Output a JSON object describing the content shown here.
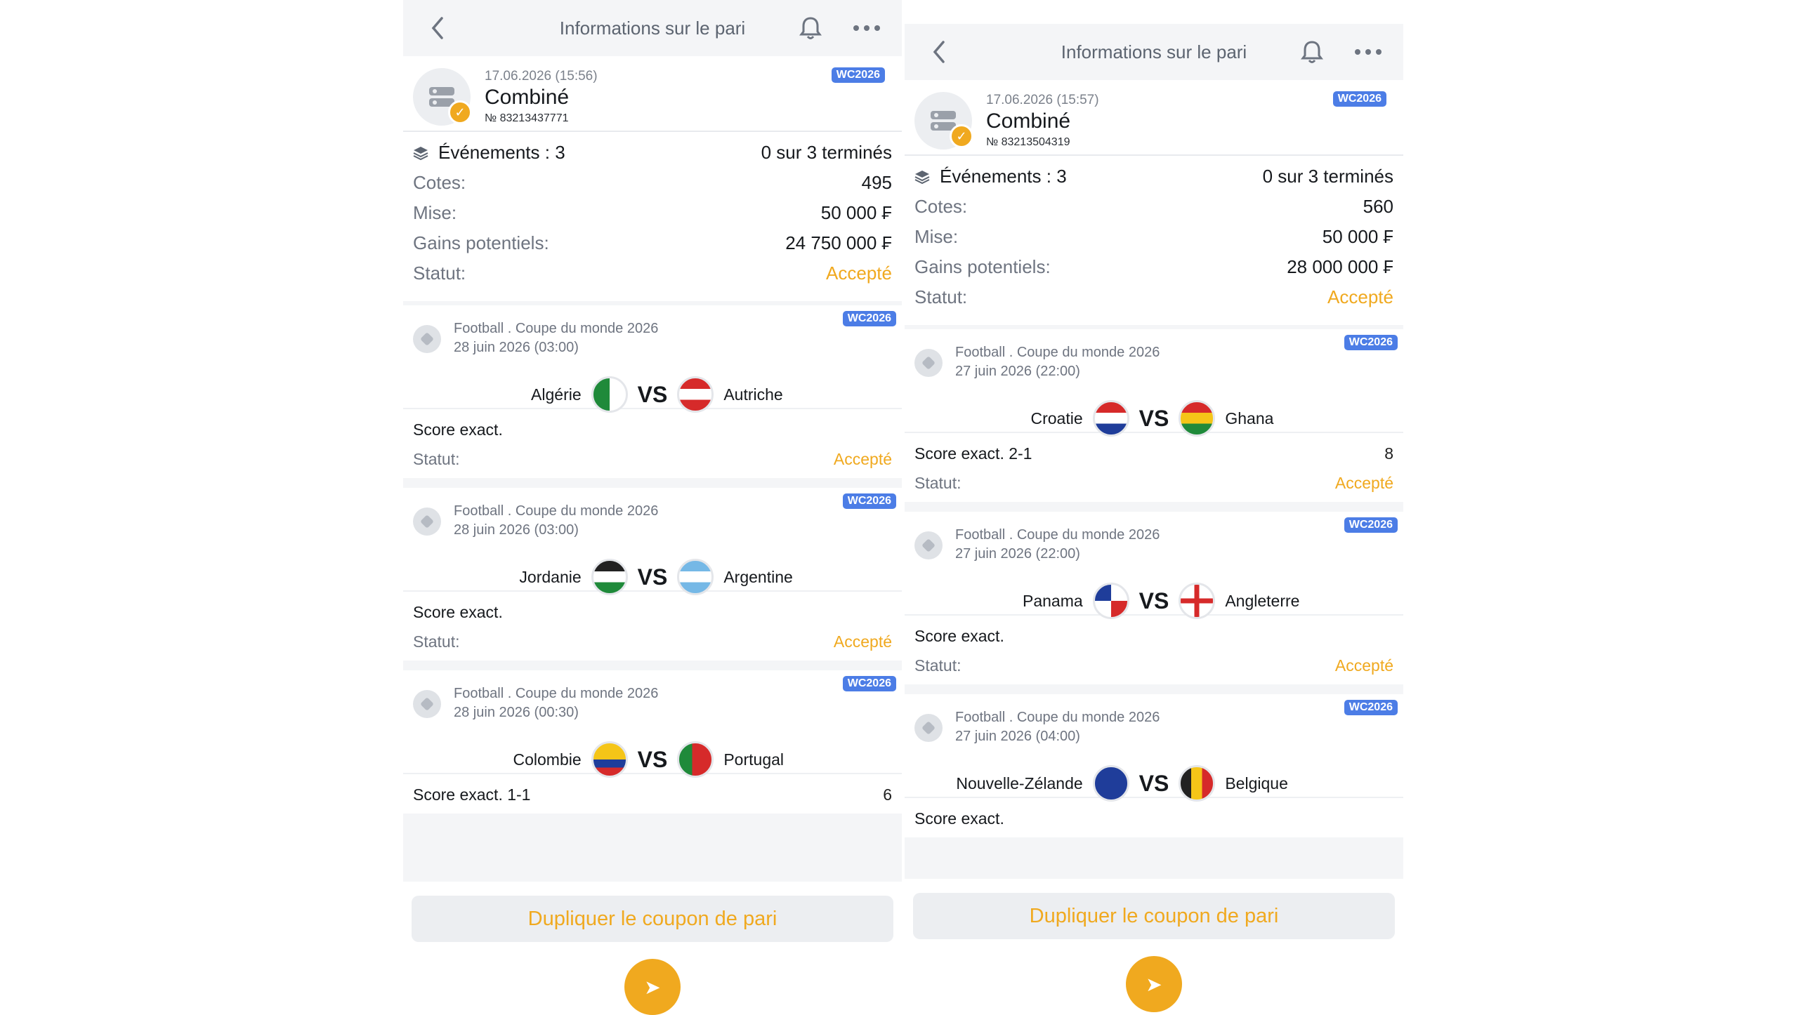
{
  "panels": [
    {
      "header_title": "Informations sur le pari",
      "bet": {
        "date": "17.06.2026 (15:56)",
        "type": "Combiné",
        "number": "№ 83213437771",
        "badge": "WC2026"
      },
      "summary": {
        "events_label": "Événements : 3",
        "events_value": "0 sur 3 terminés",
        "odds_label": "Cotes:",
        "odds_value": "495",
        "stake_label": "Mise:",
        "stake_value": "50 000 ₣",
        "potential_label": "Gains potentiels:",
        "potential_value": "24 750 000 ₣",
        "status_label": "Statut:",
        "status_value": "Accepté"
      },
      "events": [
        {
          "badge": "WC2026",
          "league": "Football . Coupe du monde 2026",
          "date": "28 juin 2026 (03:00)",
          "home": "Algérie",
          "away": "Autriche",
          "vs": "VS",
          "pick": "Score exact.",
          "pick_value": "",
          "status_label": "Statut:",
          "status_value": "Accepté"
        },
        {
          "badge": "WC2026",
          "league": "Football . Coupe du monde 2026",
          "date": "28 juin 2026 (03:00)",
          "home": "Jordanie",
          "away": "Argentine",
          "vs": "VS",
          "pick": "Score exact.",
          "pick_value": "",
          "status_label": "Statut:",
          "status_value": "Accepté"
        },
        {
          "badge": "WC2026",
          "league": "Football . Coupe du monde 2026",
          "date": "28 juin 2026 (00:30)",
          "home": "Colombie",
          "away": "Portugal",
          "vs": "VS",
          "pick": "Score exact. 1-1",
          "pick_value": "6",
          "status_label": "",
          "status_value": ""
        }
      ],
      "duplicate_button": "Dupliquer le coupon de pari"
    },
    {
      "header_title": "Informations sur le pari",
      "bet": {
        "date": "17.06.2026 (15:57)",
        "type": "Combiné",
        "number": "№ 83213504319",
        "badge": "WC2026"
      },
      "summary": {
        "events_label": "Événements : 3",
        "events_value": "0 sur 3 terminés",
        "odds_label": "Cotes:",
        "odds_value": "560",
        "stake_label": "Mise:",
        "stake_value": "50 000 ₣",
        "potential_label": "Gains potentiels:",
        "potential_value": "28 000 000 ₣",
        "status_label": "Statut:",
        "status_value": "Accepté"
      },
      "events": [
        {
          "badge": "WC2026",
          "league": "Football . Coupe du monde 2026",
          "date": "27 juin 2026 (22:00)",
          "home": "Croatie",
          "away": "Ghana",
          "vs": "VS",
          "pick": "Score exact. 2-1",
          "pick_value": "8",
          "status_label": "Statut:",
          "status_value": "Accepté"
        },
        {
          "badge": "WC2026",
          "league": "Football . Coupe du monde 2026",
          "date": "27 juin 2026 (22:00)",
          "home": "Panama",
          "away": "Angleterre",
          "vs": "VS",
          "pick": "Score exact.",
          "pick_value": "",
          "status_label": "Statut:",
          "status_value": "Accepté"
        },
        {
          "badge": "WC2026",
          "league": "Football . Coupe du monde 2026",
          "date": "27 juin 2026 (04:00)",
          "home": "Nouvelle-Zélande",
          "away": "Belgique",
          "vs": "VS",
          "pick": "Score exact.",
          "pick_value": "",
          "status_label": "",
          "status_value": ""
        }
      ],
      "duplicate_button": "Dupliquer le coupon de pari"
    }
  ],
  "icons": {
    "back": "chevron-left-icon",
    "bell": "bell-icon",
    "more": "more-icon",
    "coupon": "coupon-icon",
    "check": "check-icon",
    "layers": "layers-icon",
    "ball": "soccer-ball-icon",
    "fab": "share-icon"
  },
  "colors": {
    "accent": "#f0a91f",
    "badge": "#4c7de6",
    "muted_text": "#6e7480"
  }
}
